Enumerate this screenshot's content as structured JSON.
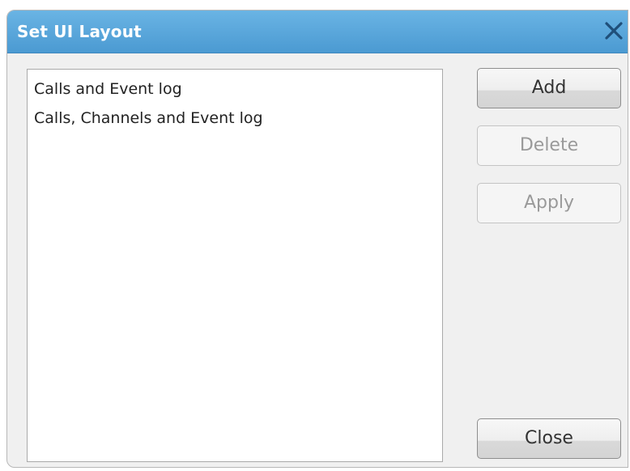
{
  "window": {
    "title": "Set UI Layout",
    "close_icon": "close-icon"
  },
  "layouts": {
    "items": [
      "Calls and Event log",
      "Calls, Channels and Event log"
    ]
  },
  "buttons": {
    "add": {
      "label": "Add",
      "enabled": true
    },
    "delete": {
      "label": "Delete",
      "enabled": false
    },
    "apply": {
      "label": "Apply",
      "enabled": false
    },
    "close": {
      "label": "Close",
      "enabled": true
    }
  },
  "colors": {
    "titlebar": "#4b9ad2",
    "title_text": "#ffffff",
    "close_icon": "#1f4f7a",
    "disabled_text": "#9a9a9a"
  }
}
